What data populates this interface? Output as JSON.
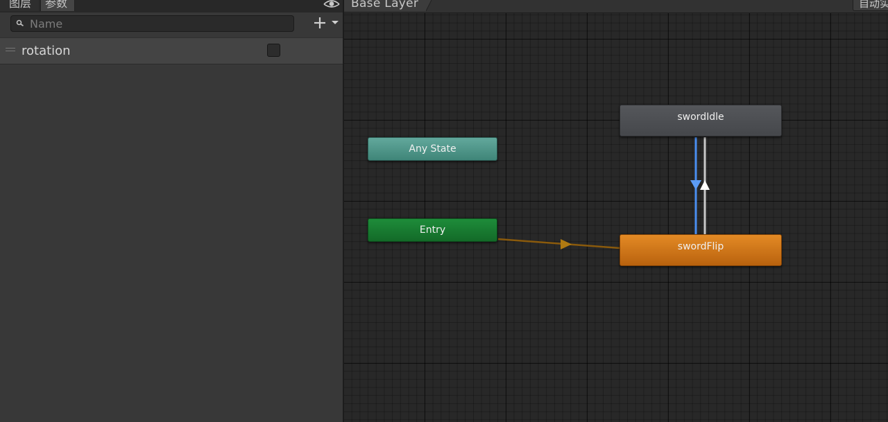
{
  "left_panel": {
    "tabs": [
      {
        "label": "图层"
      },
      {
        "label": "参数"
      }
    ],
    "search": {
      "placeholder": "Name",
      "value": ""
    },
    "parameters": [
      {
        "name": "rotation",
        "checked": false
      }
    ]
  },
  "graph": {
    "breadcrumb": "Base Layer",
    "auto_layout_label": "自动实",
    "nodes": {
      "any_state": "Any State",
      "entry": "Entry",
      "sword_idle": "swordIdle",
      "sword_flip": "swordFlip"
    },
    "colors": {
      "any_state": "#4f968a",
      "entry": "#17782f",
      "sword_idle": "#4d4f53",
      "sword_flip": "#d07519",
      "entry_transition": "#8a5a0c",
      "selected_transition": "#4a8ef0",
      "transition": "#c8c8c8"
    }
  },
  "icons": {
    "eye": "eye-icon",
    "search": "search-icon",
    "add": "plus-icon",
    "dropdown": "chevron-down-icon"
  }
}
